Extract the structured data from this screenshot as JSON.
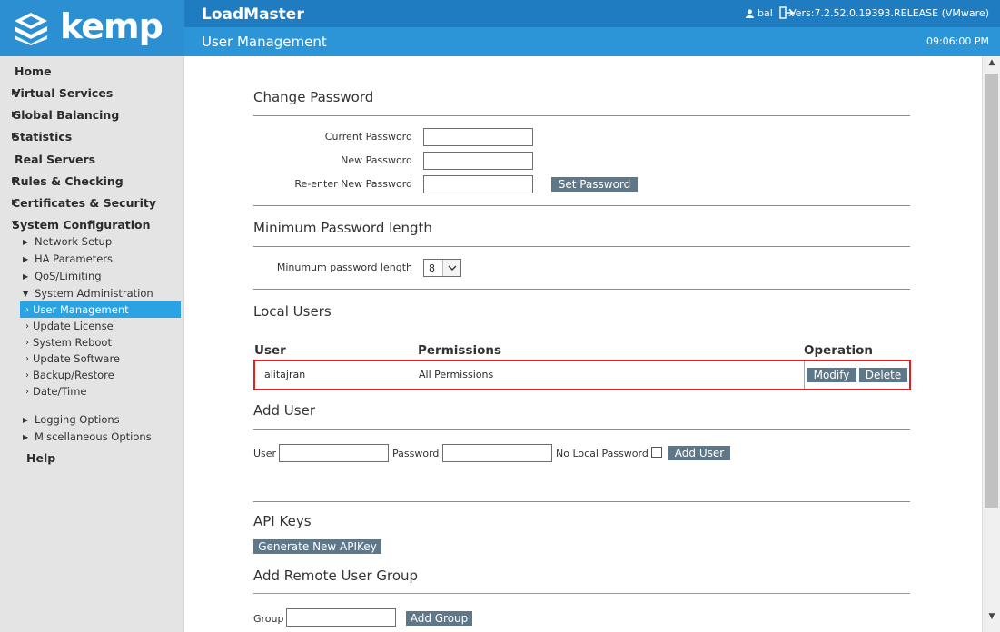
{
  "brand": {
    "logo_text": "kemp",
    "app_name": "LoadMaster",
    "accent": "#2c8fd1"
  },
  "header": {
    "page_title": "User Management",
    "user_name": "bal",
    "user_icon": "user-icon",
    "logout_icon": "logout-icon",
    "version": "Vers:7.2.52.0.19393.RELEASE (VMware)",
    "time": "09:06:00 PM"
  },
  "sidebar": {
    "top_items": [
      {
        "label": "Home",
        "arrow": ""
      },
      {
        "label": "Virtual Services",
        "arrow": "▶"
      },
      {
        "label": "Global Balancing",
        "arrow": "▶"
      },
      {
        "label": "Statistics",
        "arrow": "▶"
      },
      {
        "label": "Real Servers",
        "arrow": ""
      },
      {
        "label": "Rules & Checking",
        "arrow": "▶"
      },
      {
        "label": "Certificates & Security",
        "arrow": "▶"
      },
      {
        "label": "System Configuration",
        "arrow": "▼"
      }
    ],
    "sub_items": [
      {
        "label": "Network Setup",
        "arrow": "▶"
      },
      {
        "label": "HA Parameters",
        "arrow": "▶"
      },
      {
        "label": "QoS/Limiting",
        "arrow": "▶"
      },
      {
        "label": "System Administration",
        "arrow": "▼"
      }
    ],
    "leaf_items": [
      {
        "label": "User Management",
        "chevron": "›"
      },
      {
        "label": "Update License",
        "chevron": "›"
      },
      {
        "label": "System Reboot",
        "chevron": "›"
      },
      {
        "label": "Update Software",
        "chevron": "›"
      },
      {
        "label": "Backup/Restore",
        "chevron": "›"
      },
      {
        "label": "Date/Time",
        "chevron": "›"
      }
    ],
    "lower_sub_items": [
      {
        "label": "Logging Options",
        "arrow": "▶"
      },
      {
        "label": "Miscellaneous Options",
        "arrow": "▶"
      }
    ],
    "help": {
      "label": "Help"
    }
  },
  "change_password": {
    "title": "Change Password",
    "current_label": "Current Password",
    "new_label": "New Password",
    "reenter_label": "Re-enter New Password",
    "current_value": "",
    "new_value": "",
    "reenter_value": "",
    "set_button": "Set Password"
  },
  "min_password": {
    "title": "Minimum Password length",
    "label": "Minumum password length",
    "value": "8"
  },
  "local_users": {
    "title": "Local Users",
    "headers": {
      "user": "User",
      "permissions": "Permissions",
      "operation": "Operation"
    },
    "rows": [
      {
        "user": "alitajran",
        "permissions": "All Permissions",
        "modify": "Modify",
        "delete": "Delete"
      }
    ],
    "highlight_color": "#e02020"
  },
  "add_user": {
    "title": "Add User",
    "user_label": "User",
    "password_label": "Password",
    "no_local_label": "No Local Password",
    "user_value": "",
    "password_value": "",
    "button": "Add User"
  },
  "api_keys": {
    "title": "API Keys",
    "button": "Generate New APIKey"
  },
  "remote_group": {
    "title": "Add Remote User Group",
    "group_label": "Group",
    "group_value": "",
    "button": "Add Group"
  },
  "scroll": {
    "up_arrow": "▲",
    "down_arrow": "▼"
  }
}
